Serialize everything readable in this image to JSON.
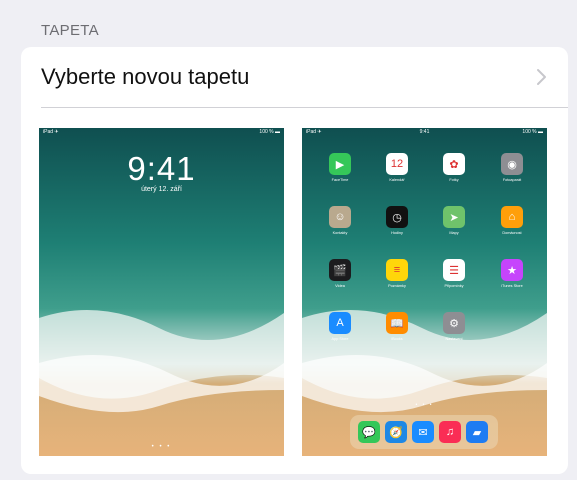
{
  "section": {
    "title": "TAPETA"
  },
  "row": {
    "label": "Vyberte novou tapetu"
  },
  "lock": {
    "status_left": "iPad ✈",
    "status_right": "100 % ▬",
    "time": "9:41",
    "date": "úterý 12. září",
    "page_dots": "• • •"
  },
  "home": {
    "status_left": "iPad ✈",
    "status_center": "9:41",
    "status_right": "100 % ▬",
    "page_dots": "• • •",
    "apps": [
      {
        "label": "FaceTime",
        "icon": "facetime-icon",
        "glyph": "▶",
        "color": "#35c759"
      },
      {
        "label": "Kalendář",
        "icon": "calendar-icon",
        "glyph": "12",
        "color": "#ffffff"
      },
      {
        "label": "Fotky",
        "icon": "photos-icon",
        "glyph": "✿",
        "color": "#ffffff"
      },
      {
        "label": "Fotoaparát",
        "icon": "camera-icon",
        "glyph": "◉",
        "color": "#8e8e93"
      },
      {
        "label": "Kontakty",
        "icon": "contacts-icon",
        "glyph": "☺",
        "color": "#b9a98e"
      },
      {
        "label": "Hodiny",
        "icon": "clock-icon",
        "glyph": "◷",
        "color": "#111111"
      },
      {
        "label": "Mapy",
        "icon": "maps-icon",
        "glyph": "➤",
        "color": "#6fc36b"
      },
      {
        "label": "Domácnost",
        "icon": "home-app-icon",
        "glyph": "⌂",
        "color": "#ff9f0a"
      },
      {
        "label": "Videa",
        "icon": "videos-icon",
        "glyph": "🎬",
        "color": "#1c1c1e"
      },
      {
        "label": "Poznámky",
        "icon": "notes-icon",
        "glyph": "≡",
        "color": "#ffd60a"
      },
      {
        "label": "Připomínky",
        "icon": "reminders-icon",
        "glyph": "☰",
        "color": "#ffffff"
      },
      {
        "label": "iTunes Store",
        "icon": "itunes-store-icon",
        "glyph": "★",
        "color": "#c644fc"
      },
      {
        "label": "App Store",
        "icon": "app-store-icon",
        "glyph": "A",
        "color": "#1a8cff"
      },
      {
        "label": "iBooks",
        "icon": "ibooks-icon",
        "glyph": "📖",
        "color": "#ff8c00"
      },
      {
        "label": "Nastavení",
        "icon": "settings-icon",
        "glyph": "⚙",
        "color": "#8e8e93"
      }
    ],
    "dock": [
      {
        "icon": "messages-icon",
        "glyph": "💬",
        "color": "#34c759"
      },
      {
        "icon": "safari-icon",
        "glyph": "🧭",
        "color": "#1e88e5"
      },
      {
        "icon": "mail-icon",
        "glyph": "✉",
        "color": "#1a8cff"
      },
      {
        "icon": "music-icon",
        "glyph": "♫",
        "color": "#fa2d55"
      },
      {
        "icon": "files-icon",
        "glyph": "▰",
        "color": "#1e7cf2"
      }
    ]
  },
  "colors": {
    "accent_background": "#efeff4",
    "chevron": "#c7c7cc"
  }
}
